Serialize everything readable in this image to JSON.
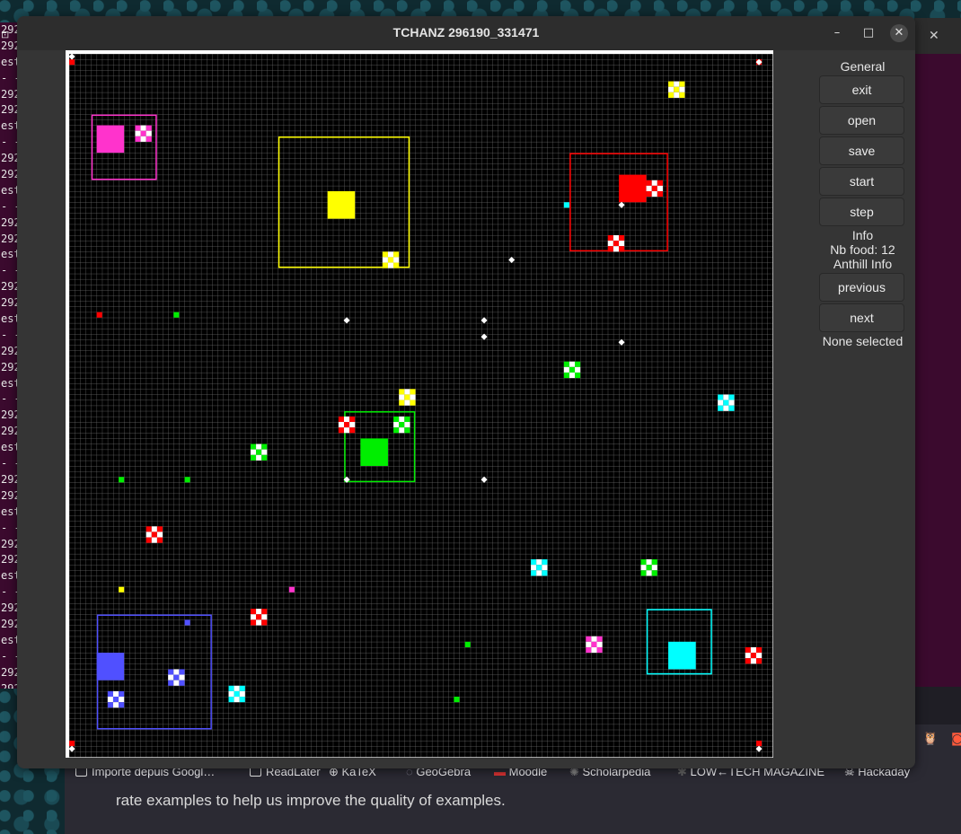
{
  "terminal": {
    "lines": [
      "292",
      "292",
      "est",
      "- - -",
      "292",
      "292",
      "est",
      "- - -",
      "292",
      "292",
      "est",
      "- - -",
      "292",
      "292",
      "est",
      "- - -",
      "292",
      "292",
      "est",
      "- - -",
      "292",
      "292",
      "est",
      "- - -",
      "292",
      "292",
      "est",
      "- - -",
      "292",
      "292",
      "est",
      "- - -",
      "292",
      "292",
      "est",
      "- - -",
      "292",
      "292",
      "est",
      "- - -",
      "292",
      "292"
    ]
  },
  "window": {
    "title": "TCHANZ 296190_331471",
    "minimize_glyph": "–",
    "maximize_glyph": "□",
    "close_glyph": "✕"
  },
  "sidebar": {
    "general_label": "General",
    "buttons": {
      "exit": "exit",
      "open": "open",
      "save": "save",
      "start": "start",
      "step": "step"
    },
    "info_label": "Info",
    "nb_food_label": "Nb food: 12",
    "anthill_info_label": "Anthill Info",
    "previous": "previous",
    "next": "next",
    "selection_status": "None selected"
  },
  "browser": {
    "bookmarks": [
      "Importe depuis Googl…",
      "ReadLater",
      "KaTeX",
      "GeoGebra",
      "Moodle",
      "Scholarpedia",
      "LOW←TECH MAGAZINE",
      "Hackaday"
    ],
    "content_text": "rate examples to help us improve the quality of examples."
  },
  "colors": {
    "pink": "#ff33cc",
    "yellow": "#ffff00",
    "red": "#ff0000",
    "green": "#00ee00",
    "blue": "#5050ff",
    "cyan": "#00ffff",
    "grid_line": "#6e6e6e",
    "world_bg": "#000000"
  },
  "icons": [
    "terminal-icon",
    "close-icon",
    "minimize-icon",
    "maximize-icon",
    "bookmark-icon",
    "globe-icon",
    "moodle-icon",
    "hackaday-icon"
  ]
}
